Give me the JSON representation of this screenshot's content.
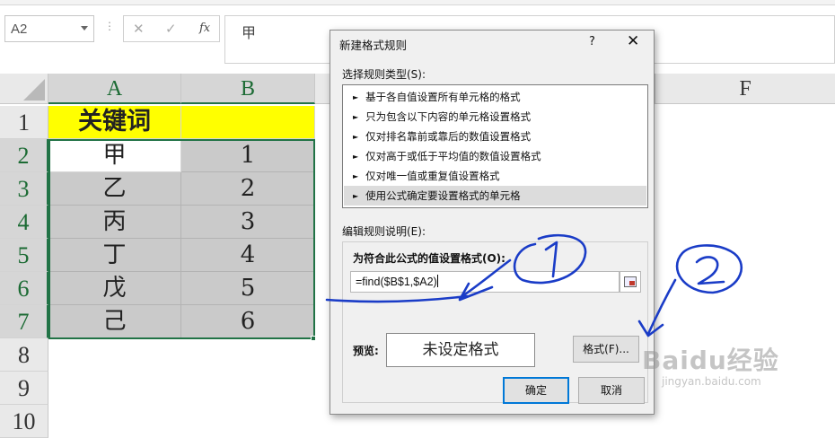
{
  "name_box": "A2",
  "formula_bar": {
    "cancel_glyph": "✕",
    "enter_glyph": "✓",
    "fx_label": "fx",
    "content": "甲"
  },
  "columns": [
    "A",
    "B",
    "F"
  ],
  "rows": [
    "1",
    "2",
    "3",
    "4",
    "5",
    "6",
    "7",
    "8",
    "9",
    "10"
  ],
  "cells": {
    "A1": "关键词",
    "B1": "",
    "A": [
      "甲",
      "乙",
      "丙",
      "丁",
      "戊",
      "己"
    ],
    "B": [
      "1",
      "2",
      "3",
      "4",
      "5",
      "6"
    ]
  },
  "dialog": {
    "title": "新建格式规则",
    "help_glyph": "?",
    "close_glyph": "✕",
    "select_type_label": "选择规则类型(S):",
    "rule_types": [
      "基于各自值设置所有单元格的格式",
      "只为包含以下内容的单元格设置格式",
      "仅对排名靠前或靠后的数值设置格式",
      "仅对高于或低于平均值的数值设置格式",
      "仅对唯一值或重复值设置格式",
      "使用公式确定要设置格式的单元格"
    ],
    "rule_arrow": "►",
    "edit_label": "编辑规则说明(E):",
    "formula_label": "为符合此公式的值设置格式(O):",
    "formula_value": "=find($B$1,$A2)",
    "preview_label": "预览:",
    "preview_text": "未设定格式",
    "format_button": "格式(F)...",
    "ok_button": "确定",
    "cancel_button": "取消"
  },
  "watermark": {
    "brand": "Baidu经验",
    "url": "jingyan.baidu.com"
  },
  "colors": {
    "selection_green": "#217346",
    "header_yellow": "#ffff00",
    "cell_gray": "#cacaca",
    "ink_blue": "#1a3cc7"
  }
}
